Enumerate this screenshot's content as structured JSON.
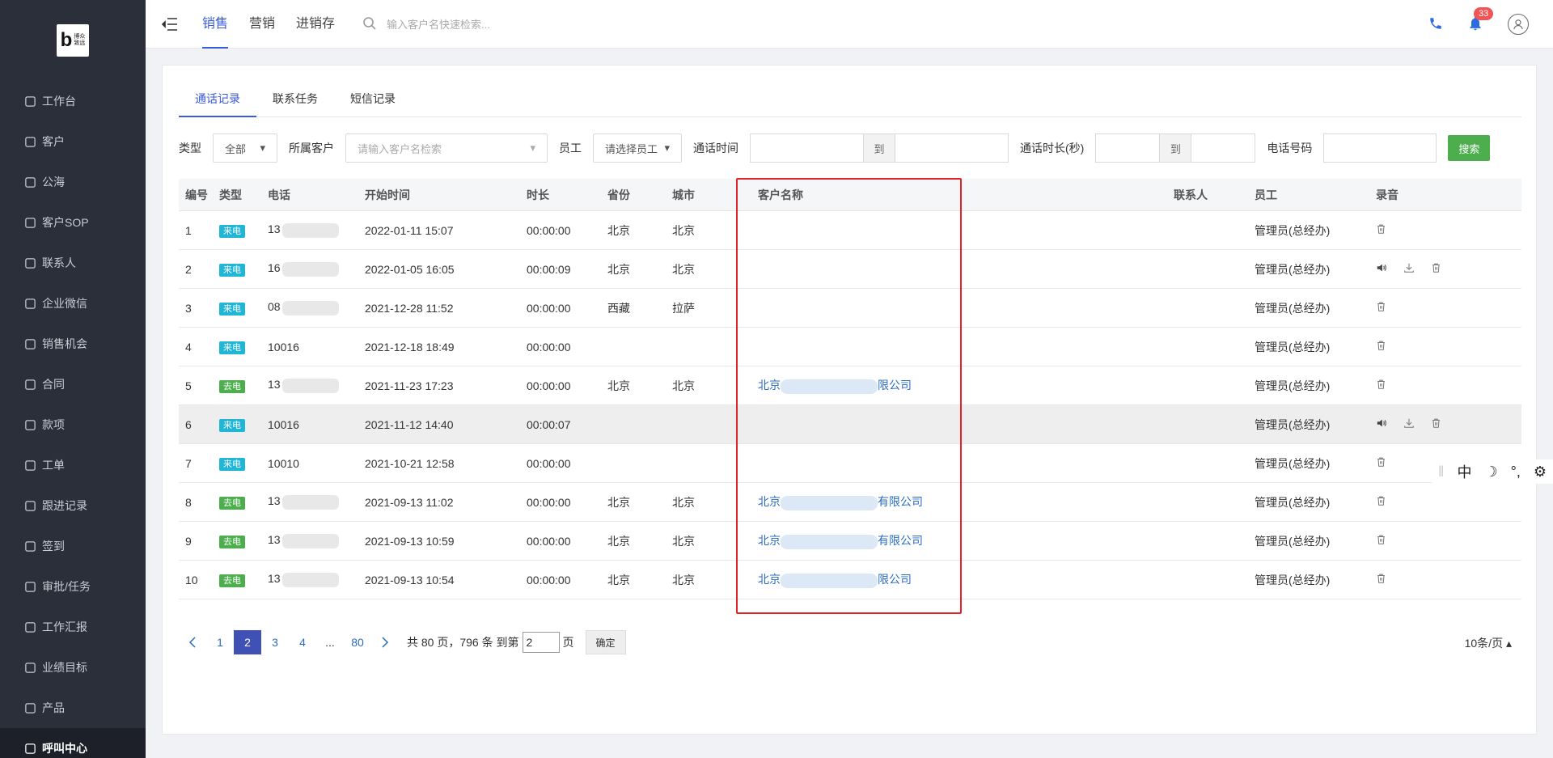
{
  "logo": {
    "letter": "b",
    "line1": "博众",
    "line2": "致远"
  },
  "sidebar": {
    "items": [
      {
        "label": "工作台",
        "icon": "dashboard-icon"
      },
      {
        "label": "客户",
        "icon": "building-icon"
      },
      {
        "label": "公海",
        "icon": "pool-icon"
      },
      {
        "label": "客户SOP",
        "icon": "sop-icon"
      },
      {
        "label": "联系人",
        "icon": "contact-icon"
      },
      {
        "label": "企业微信",
        "icon": "wechat-icon"
      },
      {
        "label": "销售机会",
        "icon": "money-bag-icon"
      },
      {
        "label": "合同",
        "icon": "contract-icon"
      },
      {
        "label": "款项",
        "icon": "payment-icon"
      },
      {
        "label": "工单",
        "icon": "ticket-icon"
      },
      {
        "label": "跟进记录",
        "icon": "edit-icon"
      },
      {
        "label": "签到",
        "icon": "checkin-icon"
      },
      {
        "label": "审批/任务",
        "icon": "approval-icon"
      },
      {
        "label": "工作汇报",
        "icon": "report-icon"
      },
      {
        "label": "业绩目标",
        "icon": "target-icon"
      },
      {
        "label": "产品",
        "icon": "product-icon"
      },
      {
        "label": "呼叫中心",
        "icon": "phone-icon"
      }
    ]
  },
  "header": {
    "tabs": [
      "销售",
      "营销",
      "进销存"
    ],
    "search_placeholder": "输入客户名快速检索...",
    "notification_count": "33"
  },
  "subtabs": [
    "通话记录",
    "联系任务",
    "短信记录"
  ],
  "filters": {
    "type_label": "类型",
    "type_value": "全部",
    "customer_label": "所属客户",
    "customer_placeholder": "请输入客户名检索",
    "staff_label": "员工",
    "staff_value": "请选择员工",
    "time_label": "通话时间",
    "to": "到",
    "duration_label": "通话时长(秒)",
    "phone_label": "电话号码",
    "search_button": "搜索"
  },
  "table": {
    "headers": [
      "编号",
      "类型",
      "电话",
      "开始时间",
      "时长",
      "省份",
      "城市",
      "客户名称",
      "联系人",
      "员工",
      "录音"
    ],
    "rows": [
      {
        "no": "1",
        "type": "来电",
        "phone": "13",
        "start": "2022-01-11 15:07",
        "duration": "00:00:00",
        "province": "北京",
        "city": "北京",
        "cust_pre": "",
        "cust_suf": "",
        "staff": "管理员(总经办)",
        "audio": false
      },
      {
        "no": "2",
        "type": "来电",
        "phone": "16",
        "start": "2022-01-05 16:05",
        "duration": "00:00:09",
        "province": "北京",
        "city": "北京",
        "cust_pre": "",
        "cust_suf": "",
        "staff": "管理员(总经办)",
        "audio": true
      },
      {
        "no": "3",
        "type": "来电",
        "phone": "08",
        "start": "2021-12-28 11:52",
        "duration": "00:00:00",
        "province": "西藏",
        "city": "拉萨",
        "cust_pre": "",
        "cust_suf": "",
        "staff": "管理员(总经办)",
        "audio": false
      },
      {
        "no": "4",
        "type": "来电",
        "phone": "10016",
        "start": "2021-12-18 18:49",
        "duration": "00:00:00",
        "province": "",
        "city": "",
        "cust_pre": "",
        "cust_suf": "",
        "staff": "管理员(总经办)",
        "audio": false
      },
      {
        "no": "5",
        "type": "去电",
        "phone": "13",
        "start": "2021-11-23 17:23",
        "duration": "00:00:00",
        "province": "北京",
        "city": "北京",
        "cust_pre": "北京",
        "cust_suf": "限公司",
        "staff": "管理员(总经办)",
        "audio": false
      },
      {
        "no": "6",
        "type": "来电",
        "phone": "10016",
        "start": "2021-11-12 14:40",
        "duration": "00:00:07",
        "province": "",
        "city": "",
        "cust_pre": "",
        "cust_suf": "",
        "staff": "管理员(总经办)",
        "audio": true
      },
      {
        "no": "7",
        "type": "来电",
        "phone": "10010",
        "start": "2021-10-21 12:58",
        "duration": "00:00:00",
        "province": "",
        "city": "",
        "cust_pre": "",
        "cust_suf": "",
        "staff": "管理员(总经办)",
        "audio": false
      },
      {
        "no": "8",
        "type": "去电",
        "phone": "13",
        "start": "2021-09-13 11:02",
        "duration": "00:00:00",
        "province": "北京",
        "city": "北京",
        "cust_pre": "北京",
        "cust_suf": "有限公司",
        "staff": "管理员(总经办)",
        "audio": false
      },
      {
        "no": "9",
        "type": "去电",
        "phone": "13",
        "start": "2021-09-13 10:59",
        "duration": "00:00:00",
        "province": "北京",
        "city": "北京",
        "cust_pre": "北京",
        "cust_suf": "有限公司",
        "staff": "管理员(总经办)",
        "audio": false
      },
      {
        "no": "10",
        "type": "去电",
        "phone": "13",
        "start": "2021-09-13 10:54",
        "duration": "00:00:00",
        "province": "北京",
        "city": "北京",
        "cust_pre": "北京",
        "cust_suf": "限公司",
        "staff": "管理员(总经办)",
        "audio": false
      }
    ]
  },
  "pagination": {
    "pages": [
      "1",
      "2",
      "3",
      "4",
      "...",
      "80"
    ],
    "current": "2",
    "summary": "共 80 页，796 条 到第",
    "goto_value": "2",
    "page_unit": "页",
    "confirm": "确定",
    "page_size": "10条/页"
  },
  "ime": {
    "mode": "中"
  },
  "colors": {
    "primary": "#3a5bd9",
    "incoming_tag": "#1fb6d8",
    "outgoing_tag": "#4cae4c",
    "sidebar_bg": "#2b2f3a",
    "highlight_box": "#e0242a"
  }
}
